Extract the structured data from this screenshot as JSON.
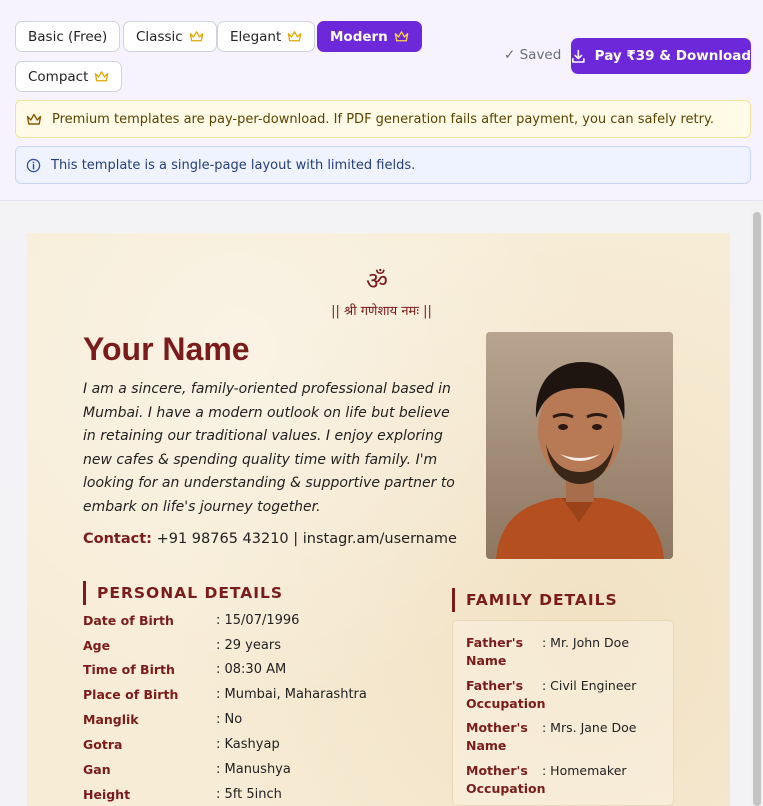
{
  "templates": [
    {
      "label": "Basic (Free)",
      "premium": false,
      "active": false
    },
    {
      "label": "Classic",
      "premium": true,
      "active": false
    },
    {
      "label": "Elegant",
      "premium": true,
      "active": false
    },
    {
      "label": "Modern",
      "premium": true,
      "active": true
    },
    {
      "label": "Compact",
      "premium": true,
      "active": false
    }
  ],
  "status": {
    "saved_label": "✓ Saved"
  },
  "pay_button": {
    "label": "Pay ₹39 & Download"
  },
  "notices": {
    "premium": "Premium templates are pay-per-download. If PDF generation fails after payment, you can safely retry.",
    "info": "This template is a single-page layout with limited fields."
  },
  "biodata": {
    "om": "ॐ",
    "mantra": "|| श्री गणेशाय नमः ||",
    "name": "Your Name",
    "bio": "I am a sincere, family-oriented professional based in Mumbai. I have a modern outlook on life but believe in retaining our traditional values. I enjoy exploring new cafes & spending quality time with family. I'm looking for an understanding & supportive partner to embark on life's journey together.",
    "contact_label": "Contact:",
    "contact_value": "+91 98765 43210 | instagr.am/username",
    "personal_title": "PERSONAL DETAILS",
    "personal": [
      {
        "key": "Date of Birth",
        "value": ": 15/07/1996"
      },
      {
        "key": "Age",
        "value": ": 29 years"
      },
      {
        "key": "Time of Birth",
        "value": ": 08:30 AM"
      },
      {
        "key": "Place of Birth",
        "value": ": Mumbai, Maharashtra"
      },
      {
        "key": "Manglik",
        "value": ": No"
      },
      {
        "key": "Gotra",
        "value": ": Kashyap"
      },
      {
        "key": "Gan",
        "value": ": Manushya"
      },
      {
        "key": "Height",
        "value": ": 5ft 5inch"
      }
    ],
    "family_title": "FAMILY DETAILS",
    "family": [
      {
        "key": "Father's Name",
        "value": ": Mr. John Doe"
      },
      {
        "key": "Father's Occupation",
        "value": ": Civil Engineer"
      },
      {
        "key": "Mother's Name",
        "value": ": Mrs. Jane Doe"
      },
      {
        "key": "Mother's Occupation",
        "value": ": Homemaker"
      }
    ]
  },
  "colors": {
    "accent": "#6d28d9",
    "maroon": "#7a1c1c",
    "crown": "#e0a800"
  }
}
